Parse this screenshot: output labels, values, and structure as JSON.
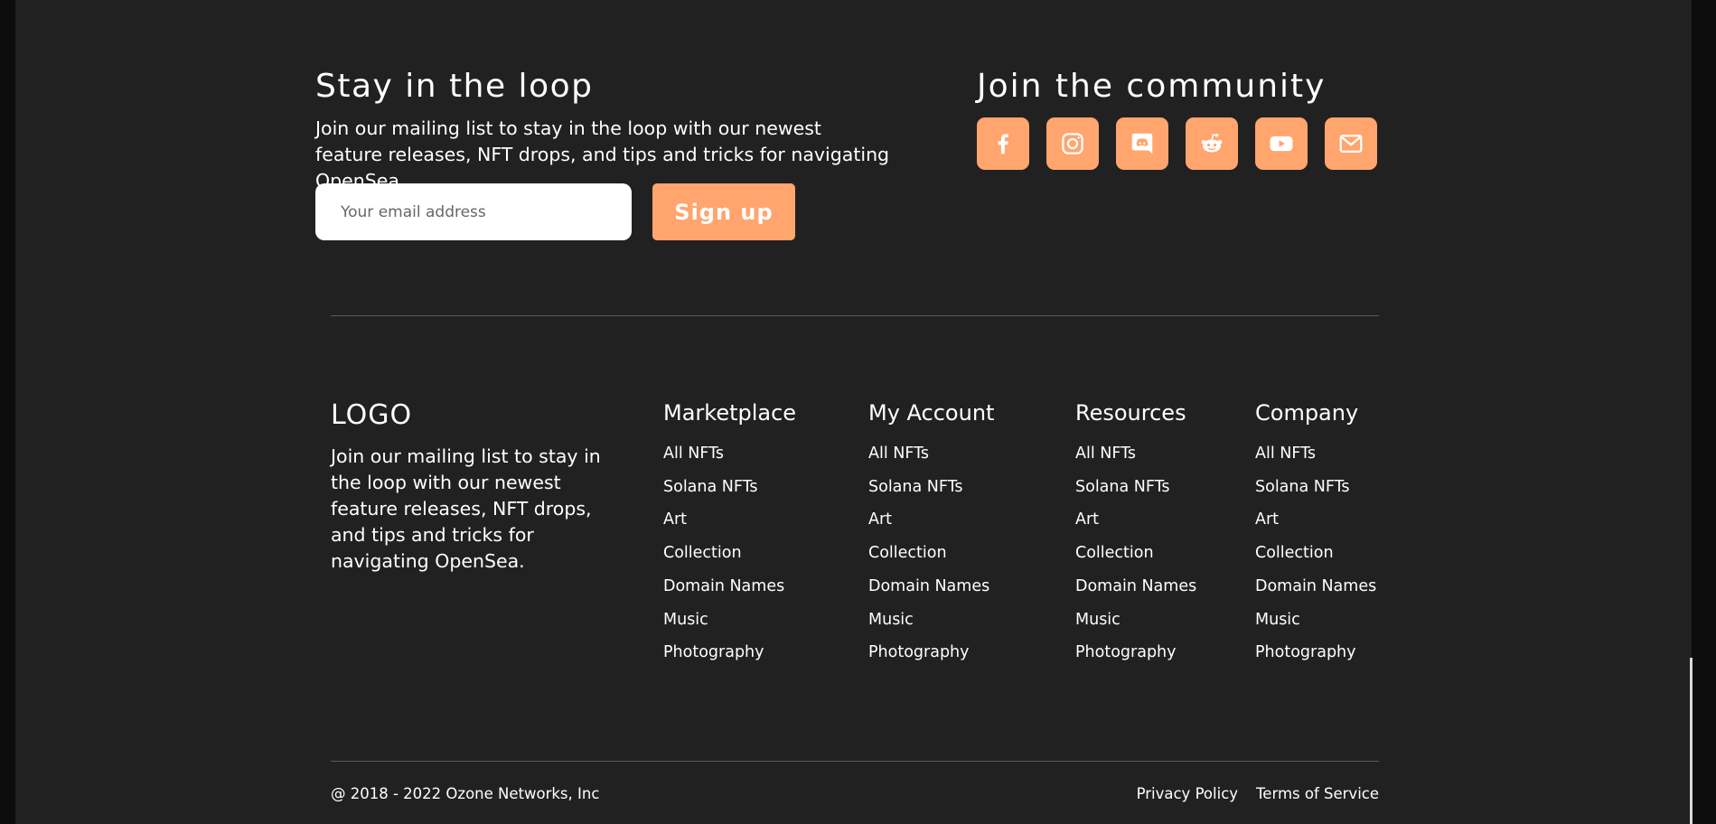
{
  "newsletter": {
    "title": "Stay in the loop",
    "text": "Join our mailing list to stay in the loop with our newest feature releases, NFT drops, and tips and tricks for navigating OpenSea.",
    "email_placeholder": "Your email address",
    "signup_label": "Sign up"
  },
  "community": {
    "title": "Join the community",
    "icons": [
      "facebook-icon",
      "instagram-icon",
      "discord-icon",
      "reddit-icon",
      "youtube-icon",
      "email-icon"
    ]
  },
  "brand": {
    "logo": "LOGO",
    "text": "Join our mailing list to stay in the loop with our newest feature releases, NFT drops, and tips and tricks for navigating OpenSea."
  },
  "columns": [
    {
      "title": "Marketplace",
      "links": [
        "All NFTs",
        "Solana NFTs",
        "Art",
        "Collection",
        "Domain Names",
        "Music",
        "Photography"
      ]
    },
    {
      "title": "My Account",
      "links": [
        "All NFTs",
        "Solana NFTs",
        "Art",
        "Collection",
        "Domain Names",
        "Music",
        "Photography"
      ]
    },
    {
      "title": "Resources",
      "links": [
        "All NFTs",
        "Solana NFTs",
        "Art",
        "Collection",
        "Domain Names",
        "Music",
        "Photography"
      ]
    },
    {
      "title": "Company",
      "links": [
        "All NFTs",
        "Solana NFTs",
        "Art",
        "Collection",
        "Domain Names",
        "Music",
        "Photography"
      ]
    }
  ],
  "footer": {
    "copyright": "@ 2018 - 2022 Ozone Networks, Inc",
    "privacy": "Privacy Policy",
    "terms": "Terms of Service"
  },
  "colors": {
    "background": "#212121",
    "accent": "#ffa56d"
  }
}
